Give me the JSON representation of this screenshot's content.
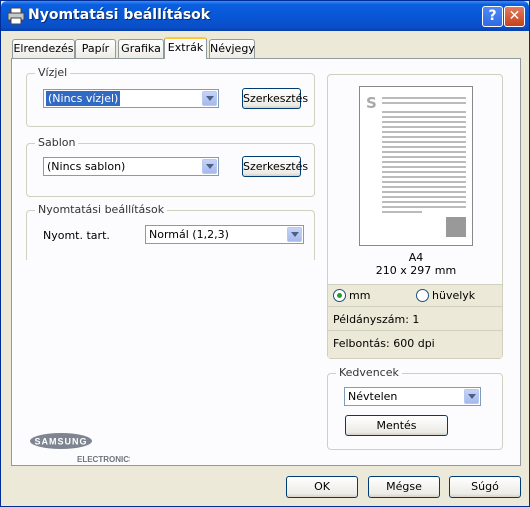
{
  "window": {
    "title": "Nyomtatási beállítások",
    "help_label": "?",
    "close_label": "✕"
  },
  "tabs": [
    {
      "label": "Elrendezés"
    },
    {
      "label": "Papír"
    },
    {
      "label": "Grafika"
    },
    {
      "label": "Extrák"
    },
    {
      "label": "Névjegy"
    }
  ],
  "watermark": {
    "title": "Vízjel",
    "value": "(Nincs vízjel)",
    "edit_label": "Szerkesztés"
  },
  "overlay": {
    "title": "Sablon",
    "value": "(Nincs sablon)",
    "edit_label": "Szerkesztés"
  },
  "output": {
    "title": "Nyomtatási beállítások",
    "order_label": "Nyomt. tart.",
    "order_value": "Normál (1,2,3)"
  },
  "preview": {
    "paper_name": "A4",
    "paper_size": "210 x 297 mm",
    "units": [
      {
        "label": "mm",
        "selected": true
      },
      {
        "label": "hüvelyk",
        "selected": false
      }
    ],
    "copies": "Példányszám: 1",
    "resolution": "Felbontás: 600 dpi"
  },
  "favorites": {
    "title": "Kedvencek",
    "value": "Névtelen",
    "save_label": "Mentés"
  },
  "logo": {
    "brand": "SAMSUNG",
    "sub": "ELECTRONICS"
  },
  "dialog_buttons": {
    "ok": "OK",
    "cancel": "Mégse",
    "help": "Súgó"
  },
  "colors": {
    "titlebar": "#0A5FDF",
    "selection": "#316AC5",
    "dialog_bg": "#ECE9D8"
  },
  "icons": {
    "title": "printer-icon",
    "dropdown": "chevron-down-icon"
  }
}
